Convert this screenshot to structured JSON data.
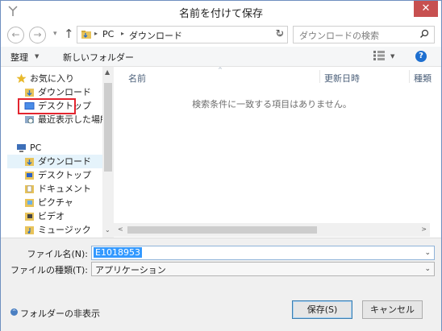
{
  "window": {
    "title": "名前を付けて保存",
    "close_glyph": "✕"
  },
  "nav": {
    "back_glyph": "←",
    "forward_glyph": "→",
    "recent_glyph": "▾",
    "up_glyph": "↑",
    "address": {
      "crumbs": [
        "PC",
        "ダウンロード"
      ],
      "separator": "▸",
      "dropdown_glyph": "⌄"
    },
    "refresh_glyph": "↻",
    "search_placeholder": "ダウンロードの検索"
  },
  "toolbar": {
    "organize_label": "整理",
    "organize_arrow": "▼",
    "new_folder_label": "新しいフォルダー",
    "view_arrow": "▼",
    "help_glyph": "?"
  },
  "navigation_pane": {
    "favorites": [
      {
        "label": "お気に入り",
        "icon": "star-icon"
      },
      {
        "label": "ダウンロード",
        "icon": "download-folder-icon"
      },
      {
        "label": "デスクトップ",
        "icon": "desktop-icon",
        "highlighted": true
      },
      {
        "label": "最近表示した場所",
        "icon": "recent-places-icon"
      }
    ],
    "pc": [
      {
        "label": "PC",
        "icon": "computer-icon"
      },
      {
        "label": "ダウンロード",
        "icon": "download-folder-icon",
        "selected": true
      },
      {
        "label": "デスクトップ",
        "icon": "desktop-icon"
      },
      {
        "label": "ドキュメント",
        "icon": "documents-icon"
      },
      {
        "label": "ピクチャ",
        "icon": "pictures-icon"
      },
      {
        "label": "ビデオ",
        "icon": "videos-icon"
      },
      {
        "label": "ミュージック",
        "icon": "music-icon"
      }
    ],
    "scroll_up_glyph": "▲",
    "scroll_down_glyph": "⌄"
  },
  "file_list": {
    "columns": [
      "名前",
      "更新日時",
      "種類"
    ],
    "sort_glyph": "^",
    "empty_message": "検索条件に一致する項目はありません。",
    "scroll_left_glyph": "<",
    "scroll_right_glyph": ">"
  },
  "fields": {
    "filename_label": "ファイル名(N):",
    "filename_value": "E1018953",
    "filetype_label": "ファイルの種類(T):",
    "filetype_value": "アプリケーション",
    "dropdown_glyph": "⌄"
  },
  "footer": {
    "hide_folders_label": "フォルダーの非表示",
    "hide_folders_glyph": "^",
    "save_label": "保存(S)",
    "cancel_label": "キャンセル"
  },
  "colors": {
    "accent": "#3399ff",
    "highlight_box": "#e3252f",
    "close": "#c75050"
  }
}
